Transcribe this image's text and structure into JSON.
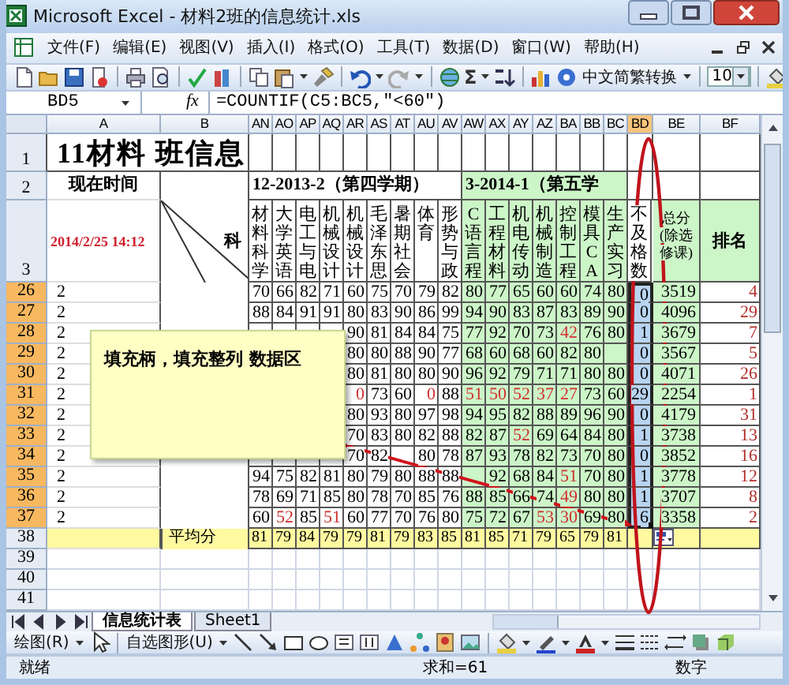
{
  "window": {
    "title": "Microsoft Excel - 材料2班的信息统计.xls"
  },
  "menu": [
    {
      "label": "文件(F)"
    },
    {
      "label": "编辑(E)"
    },
    {
      "label": "视图(V)"
    },
    {
      "label": "插入(I)"
    },
    {
      "label": "格式(O)"
    },
    {
      "label": "工具(T)"
    },
    {
      "label": "数据(D)"
    },
    {
      "label": "窗口(W)"
    },
    {
      "label": "帮助(H)"
    }
  ],
  "toolbar": {
    "sum_symbol": "Σ",
    "convert_button": "中文简繁转换",
    "font_size": "10"
  },
  "formula_bar": {
    "name_box": "BD5",
    "fx": "fx",
    "formula": "=COUNTIF(C5:BC5,\"<60\")"
  },
  "sheet": {
    "columns": [
      {
        "label": "A",
        "selected": false
      },
      {
        "label": "B",
        "selected": false
      },
      {
        "label": "AN",
        "selected": false
      },
      {
        "label": "AO",
        "selected": false
      },
      {
        "label": "AP",
        "selected": false
      },
      {
        "label": "AQ",
        "selected": false
      },
      {
        "label": "AR",
        "selected": false
      },
      {
        "label": "AS",
        "selected": false
      },
      {
        "label": "AT",
        "selected": false
      },
      {
        "label": "AU",
        "selected": false
      },
      {
        "label": "AV",
        "selected": false
      },
      {
        "label": "AW",
        "selected": false
      },
      {
        "label": "AX",
        "selected": false
      },
      {
        "label": "AY",
        "selected": false
      },
      {
        "label": "AZ",
        "selected": false
      },
      {
        "label": "BA",
        "selected": false
      },
      {
        "label": "BB",
        "selected": false
      },
      {
        "label": "BC",
        "selected": false
      },
      {
        "label": "BD",
        "selected": true
      },
      {
        "label": "BE",
        "selected": false
      },
      {
        "label": "BF",
        "selected": false
      }
    ],
    "title_row": {
      "row": "1",
      "selected": false,
      "text": "11材料  班信息"
    },
    "info_row": {
      "row": "2",
      "selected": false,
      "label": "现在时间",
      "term_1": "12-2013-2（第四学期）",
      "term_2": "3-2014-1（第五学"
    },
    "header_row": {
      "row": "3",
      "selected": false,
      "date": "2014/2/25 14:12",
      "subject_label": "科",
      "subjects": [
        "材料科学",
        "大学英语",
        "电工与电",
        "机械设计",
        "机械设计",
        "毛泽东思",
        "暑期社会",
        "体育",
        "形势与政",
        "C语言程",
        "工程材料",
        "机电传动",
        "机械制造",
        "控制工程",
        "模具CA",
        "生产实习"
      ],
      "fail_count": "不及格数",
      "total": "总分(除选修课)",
      "rank": "排名"
    },
    "rows": [
      {
        "row": "26",
        "selected": true,
        "a": "2",
        "scores": [
          {
            "kind": "score",
            "text": "70",
            "low": false
          },
          {
            "kind": "score",
            "text": "66",
            "low": false
          },
          {
            "kind": "score",
            "text": "82",
            "low": false
          },
          {
            "kind": "score",
            "text": "71",
            "low": false
          },
          {
            "kind": "score",
            "text": "60",
            "low": false
          },
          {
            "kind": "score",
            "text": "75",
            "low": false
          },
          {
            "kind": "score",
            "text": "70",
            "low": false
          },
          {
            "kind": "score",
            "text": "79",
            "low": false
          },
          {
            "kind": "score",
            "text": "82",
            "low": false
          },
          {
            "kind": "score",
            "text": "80",
            "low": false
          },
          {
            "kind": "score",
            "text": "77",
            "low": false
          },
          {
            "kind": "score",
            "text": "65",
            "low": false
          },
          {
            "kind": "score",
            "text": "60",
            "low": false
          },
          {
            "kind": "score",
            "text": "60",
            "low": false
          },
          {
            "kind": "score",
            "text": "74",
            "low": false
          },
          {
            "kind": "score",
            "text": "80",
            "low": false
          }
        ],
        "fail": "0",
        "total": "3519",
        "rank": "4"
      },
      {
        "row": "27",
        "selected": true,
        "a": "2",
        "scores": [
          {
            "kind": "score",
            "text": "88",
            "low": false
          },
          {
            "kind": "score",
            "text": "84",
            "low": false
          },
          {
            "kind": "score",
            "text": "91",
            "low": false
          },
          {
            "kind": "score",
            "text": "91",
            "low": false
          },
          {
            "kind": "score",
            "text": "80",
            "low": false
          },
          {
            "kind": "score",
            "text": "83",
            "low": false
          },
          {
            "kind": "score",
            "text": "90",
            "low": false
          },
          {
            "kind": "score",
            "text": "86",
            "low": false
          },
          {
            "kind": "score",
            "text": "99",
            "low": false
          },
          {
            "kind": "score",
            "text": "94",
            "low": false
          },
          {
            "kind": "score",
            "text": "90",
            "low": false
          },
          {
            "kind": "score",
            "text": "83",
            "low": false
          },
          {
            "kind": "score",
            "text": "87",
            "low": false
          },
          {
            "kind": "score",
            "text": "83",
            "low": false
          },
          {
            "kind": "score",
            "text": "89",
            "low": false
          },
          {
            "kind": "score",
            "text": "90",
            "low": false
          }
        ],
        "fail": "0",
        "total": "4096",
        "rank": "29"
      },
      {
        "row": "28",
        "selected": true,
        "a": "2",
        "scores": [
          {
            "kind": "covered"
          },
          {
            "kind": "covered"
          },
          {
            "kind": "covered"
          },
          {
            "kind": "covered"
          },
          {
            "kind": "score",
            "text": "90",
            "low": false
          },
          {
            "kind": "score",
            "text": "81",
            "low": false
          },
          {
            "kind": "score",
            "text": "84",
            "low": false
          },
          {
            "kind": "score",
            "text": "84",
            "low": false
          },
          {
            "kind": "score",
            "text": "75",
            "low": false
          },
          {
            "kind": "score",
            "text": "77",
            "low": false
          },
          {
            "kind": "score",
            "text": "92",
            "low": false
          },
          {
            "kind": "score",
            "text": "70",
            "low": false
          },
          {
            "kind": "score",
            "text": "73",
            "low": false
          },
          {
            "kind": "score",
            "text": "42",
            "low": true
          },
          {
            "kind": "score",
            "text": "76",
            "low": false
          },
          {
            "kind": "score",
            "text": "80",
            "low": false
          }
        ],
        "fail": "1",
        "total": "3679",
        "rank": "7"
      },
      {
        "row": "29",
        "selected": true,
        "a": "2",
        "scores": [
          {
            "kind": "covered"
          },
          {
            "kind": "covered"
          },
          {
            "kind": "covered"
          },
          {
            "kind": "covered"
          },
          {
            "kind": "score",
            "text": "80",
            "low": false
          },
          {
            "kind": "score",
            "text": "80",
            "low": false
          },
          {
            "kind": "score",
            "text": "88",
            "low": false
          },
          {
            "kind": "score",
            "text": "90",
            "low": false
          },
          {
            "kind": "score",
            "text": "77",
            "low": false
          },
          {
            "kind": "score",
            "text": "68",
            "low": false
          },
          {
            "kind": "score",
            "text": "60",
            "low": false
          },
          {
            "kind": "score",
            "text": "68",
            "low": false
          },
          {
            "kind": "score",
            "text": "60",
            "low": false
          },
          {
            "kind": "score",
            "text": "82",
            "low": false
          },
          {
            "kind": "score",
            "text": "80",
            "low": false
          },
          {
            "kind": "blank"
          }
        ],
        "fail": "0",
        "total": "3567",
        "rank": "5"
      },
      {
        "row": "30",
        "selected": true,
        "a": "2",
        "scores": [
          {
            "kind": "covered"
          },
          {
            "kind": "covered"
          },
          {
            "kind": "covered"
          },
          {
            "kind": "covered"
          },
          {
            "kind": "score",
            "text": "80",
            "low": false
          },
          {
            "kind": "score",
            "text": "81",
            "low": false
          },
          {
            "kind": "score",
            "text": "80",
            "low": false
          },
          {
            "kind": "score",
            "text": "80",
            "low": false
          },
          {
            "kind": "score",
            "text": "90",
            "low": false
          },
          {
            "kind": "score",
            "text": "96",
            "low": false
          },
          {
            "kind": "score",
            "text": "92",
            "low": false
          },
          {
            "kind": "score",
            "text": "79",
            "low": false
          },
          {
            "kind": "score",
            "text": "71",
            "low": false
          },
          {
            "kind": "score",
            "text": "71",
            "low": false
          },
          {
            "kind": "score",
            "text": "80",
            "low": false
          },
          {
            "kind": "score",
            "text": "80",
            "low": false
          }
        ],
        "fail": "0",
        "total": "4071",
        "rank": "26"
      },
      {
        "row": "31",
        "selected": true,
        "a": "2",
        "scores": [
          {
            "kind": "covered"
          },
          {
            "kind": "covered"
          },
          {
            "kind": "covered"
          },
          {
            "kind": "covered"
          },
          {
            "kind": "score",
            "text": "0",
            "low": true
          },
          {
            "kind": "score",
            "text": "73",
            "low": false
          },
          {
            "kind": "score",
            "text": "60",
            "low": false
          },
          {
            "kind": "score",
            "text": "0",
            "low": true
          },
          {
            "kind": "score",
            "text": "88",
            "low": false
          },
          {
            "kind": "score",
            "text": "51",
            "low": true
          },
          {
            "kind": "score",
            "text": "50",
            "low": true
          },
          {
            "kind": "score",
            "text": "52",
            "low": true
          },
          {
            "kind": "score",
            "text": "37",
            "low": true
          },
          {
            "kind": "score",
            "text": "27",
            "low": true
          },
          {
            "kind": "score",
            "text": "73",
            "low": false
          },
          {
            "kind": "score",
            "text": "60",
            "low": false
          }
        ],
        "fail": "29",
        "total": "2254",
        "rank": "1"
      },
      {
        "row": "32",
        "selected": true,
        "a": "2",
        "scores": [
          {
            "kind": "covered"
          },
          {
            "kind": "covered"
          },
          {
            "kind": "covered"
          },
          {
            "kind": "covered"
          },
          {
            "kind": "score",
            "text": "80",
            "low": false
          },
          {
            "kind": "score",
            "text": "93",
            "low": false
          },
          {
            "kind": "score",
            "text": "80",
            "low": false
          },
          {
            "kind": "score",
            "text": "97",
            "low": false
          },
          {
            "kind": "score",
            "text": "98",
            "low": false
          },
          {
            "kind": "score",
            "text": "94",
            "low": false
          },
          {
            "kind": "score",
            "text": "95",
            "low": false
          },
          {
            "kind": "score",
            "text": "82",
            "low": false
          },
          {
            "kind": "score",
            "text": "88",
            "low": false
          },
          {
            "kind": "score",
            "text": "89",
            "low": false
          },
          {
            "kind": "score",
            "text": "96",
            "low": false
          },
          {
            "kind": "score",
            "text": "90",
            "low": false
          }
        ],
        "fail": "0",
        "total": "4179",
        "rank": "31"
      },
      {
        "row": "33",
        "selected": true,
        "a": "2",
        "scores": [
          {
            "kind": "covered"
          },
          {
            "kind": "covered"
          },
          {
            "kind": "covered"
          },
          {
            "kind": "covered"
          },
          {
            "kind": "score",
            "text": "70",
            "low": false
          },
          {
            "kind": "score",
            "text": "83",
            "low": false
          },
          {
            "kind": "score",
            "text": "80",
            "low": false
          },
          {
            "kind": "score",
            "text": "82",
            "low": false
          },
          {
            "kind": "score",
            "text": "88",
            "low": false
          },
          {
            "kind": "score",
            "text": "82",
            "low": false
          },
          {
            "kind": "score",
            "text": "87",
            "low": false
          },
          {
            "kind": "score",
            "text": "52",
            "low": true
          },
          {
            "kind": "score",
            "text": "69",
            "low": false
          },
          {
            "kind": "score",
            "text": "64",
            "low": false
          },
          {
            "kind": "score",
            "text": "84",
            "low": false
          },
          {
            "kind": "score",
            "text": "80",
            "low": false
          }
        ],
        "fail": "1",
        "total": "3738",
        "rank": "13"
      },
      {
        "row": "34",
        "selected": true,
        "a": "2",
        "scores": [
          {
            "kind": "covered"
          },
          {
            "kind": "covered"
          },
          {
            "kind": "covered"
          },
          {
            "kind": "covered"
          },
          {
            "kind": "score",
            "text": "70",
            "low": false
          },
          {
            "kind": "score",
            "text": "82",
            "low": false
          },
          {
            "kind": "covered"
          },
          {
            "kind": "score",
            "text": "80",
            "low": false
          },
          {
            "kind": "score",
            "text": "78",
            "low": false
          },
          {
            "kind": "score",
            "text": "87",
            "low": false
          },
          {
            "kind": "score",
            "text": "93",
            "low": false
          },
          {
            "kind": "score",
            "text": "78",
            "low": false
          },
          {
            "kind": "score",
            "text": "82",
            "low": false
          },
          {
            "kind": "score",
            "text": "73",
            "low": false
          },
          {
            "kind": "score",
            "text": "70",
            "low": false
          },
          {
            "kind": "score",
            "text": "80",
            "low": false
          }
        ],
        "fail": "0",
        "total": "3852",
        "rank": "16"
      },
      {
        "row": "35",
        "selected": true,
        "a": "2",
        "scores": [
          {
            "kind": "score",
            "text": "94",
            "low": false
          },
          {
            "kind": "score",
            "text": "75",
            "low": false
          },
          {
            "kind": "score",
            "text": "82",
            "low": false
          },
          {
            "kind": "score",
            "text": "81",
            "low": false
          },
          {
            "kind": "score",
            "text": "80",
            "low": false
          },
          {
            "kind": "score",
            "text": "79",
            "low": false
          },
          {
            "kind": "score",
            "text": "80",
            "low": false
          },
          {
            "kind": "score",
            "text": "88",
            "low": false
          },
          {
            "kind": "score",
            "text": "88",
            "low": false
          },
          {
            "kind": "covered"
          },
          {
            "kind": "score",
            "text": "92",
            "low": false
          },
          {
            "kind": "score",
            "text": "68",
            "low": false
          },
          {
            "kind": "score",
            "text": "84",
            "low": false
          },
          {
            "kind": "score",
            "text": "51",
            "low": true
          },
          {
            "kind": "score",
            "text": "70",
            "low": false
          },
          {
            "kind": "score",
            "text": "80",
            "low": false
          }
        ],
        "fail": "1",
        "total": "3778",
        "rank": "12"
      },
      {
        "row": "36",
        "selected": true,
        "a": "2",
        "scores": [
          {
            "kind": "score",
            "text": "78",
            "low": false
          },
          {
            "kind": "score",
            "text": "69",
            "low": false
          },
          {
            "kind": "score",
            "text": "71",
            "low": false
          },
          {
            "kind": "score",
            "text": "85",
            "low": false
          },
          {
            "kind": "score",
            "text": "80",
            "low": false
          },
          {
            "kind": "score",
            "text": "78",
            "low": false
          },
          {
            "kind": "score",
            "text": "70",
            "low": false
          },
          {
            "kind": "score",
            "text": "85",
            "low": false
          },
          {
            "kind": "score",
            "text": "76",
            "low": false
          },
          {
            "kind": "score",
            "text": "88",
            "low": false
          },
          {
            "kind": "score",
            "text": "85",
            "low": false
          },
          {
            "kind": "score",
            "text": "66",
            "low": false
          },
          {
            "kind": "score",
            "text": "74",
            "low": false
          },
          {
            "kind": "score",
            "text": "49",
            "low": true
          },
          {
            "kind": "score",
            "text": "80",
            "low": false
          },
          {
            "kind": "score",
            "text": "80",
            "low": false
          }
        ],
        "fail": "1",
        "total": "3707",
        "rank": "8"
      },
      {
        "row": "37",
        "selected": true,
        "a": "2",
        "scores": [
          {
            "kind": "score",
            "text": "60",
            "low": false
          },
          {
            "kind": "score",
            "text": "52",
            "low": true
          },
          {
            "kind": "score",
            "text": "85",
            "low": false
          },
          {
            "kind": "score",
            "text": "51",
            "low": true
          },
          {
            "kind": "score",
            "text": "60",
            "low": false
          },
          {
            "kind": "score",
            "text": "77",
            "low": false
          },
          {
            "kind": "score",
            "text": "70",
            "low": false
          },
          {
            "kind": "score",
            "text": "76",
            "low": false
          },
          {
            "kind": "score",
            "text": "80",
            "low": false
          },
          {
            "kind": "score",
            "text": "75",
            "low": false
          },
          {
            "kind": "score",
            "text": "72",
            "low": false
          },
          {
            "kind": "score",
            "text": "67",
            "low": false
          },
          {
            "kind": "score",
            "text": "53",
            "low": true
          },
          {
            "kind": "score",
            "text": "30",
            "low": true
          },
          {
            "kind": "score",
            "text": "69",
            "low": false
          },
          {
            "kind": "score",
            "text": "80",
            "low": false
          }
        ],
        "fail": "6",
        "total": "3358",
        "rank": "2"
      }
    ],
    "average_row": {
      "row": "38",
      "selected": false,
      "label": "平均分",
      "scores": [
        "81",
        "79",
        "84",
        "79",
        "79",
        "81",
        "79",
        "83",
        "85",
        "81",
        "85",
        "71",
        "79",
        "65",
        "79",
        "81"
      ]
    },
    "empty_rows": [
      {
        "row": "39",
        "selected": false
      },
      {
        "row": "40",
        "selected": false
      },
      {
        "row": "41",
        "selected": false
      }
    ]
  },
  "callout": {
    "text": "填充柄，填充整列 数据区"
  },
  "sheet_tabs": [
    {
      "label": "信息统计表",
      "selected": true
    },
    {
      "label": "Sheet1",
      "selected": false
    }
  ],
  "drawing_toolbar": {
    "draw_menu": "绘图(R)",
    "autoshapes": "自选图形(U)"
  },
  "status_bar": {
    "mode": "就绪",
    "sum": "求和=61",
    "num_lock": "数字"
  }
}
